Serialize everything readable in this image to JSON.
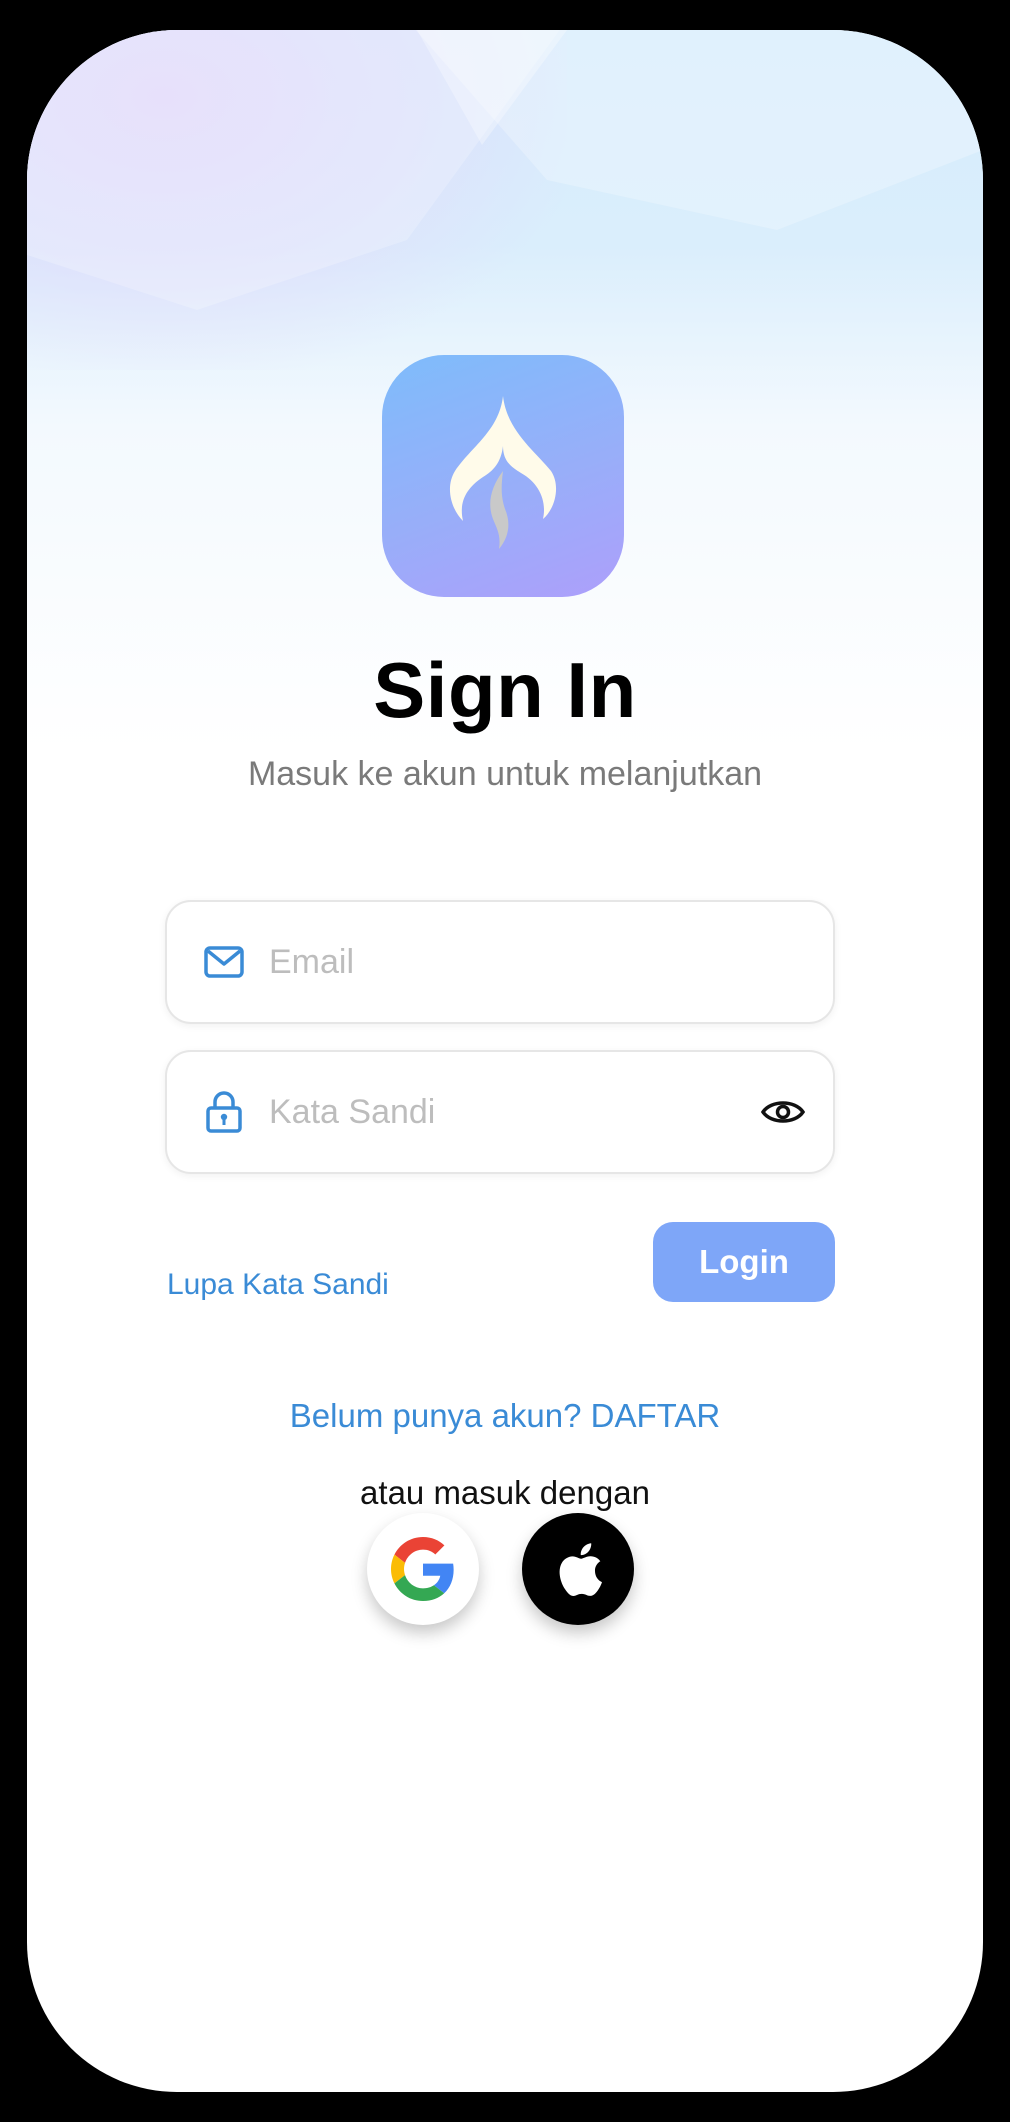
{
  "header": {
    "title": "Sign In",
    "subtitle": "Masuk ke akun untuk melanjutkan"
  },
  "form": {
    "email_placeholder": "Email",
    "password_placeholder": "Kata Sandi",
    "forgot_label": "Lupa Kata Sandi",
    "login_label": "Login"
  },
  "footer": {
    "register_label": "Belum punya akun? DAFTAR",
    "alt_login_label": "atau masuk dengan"
  },
  "icons": {
    "logo": "flame-icon",
    "email": "mail-icon",
    "password": "lock-icon",
    "visibility": "eye-icon",
    "google": "google-icon",
    "apple": "apple-icon"
  },
  "colors": {
    "accent": "#3a8bd6",
    "button": "#7ea6f8",
    "logo_start": "#7ebcfb",
    "logo_end": "#ad9ffb"
  }
}
